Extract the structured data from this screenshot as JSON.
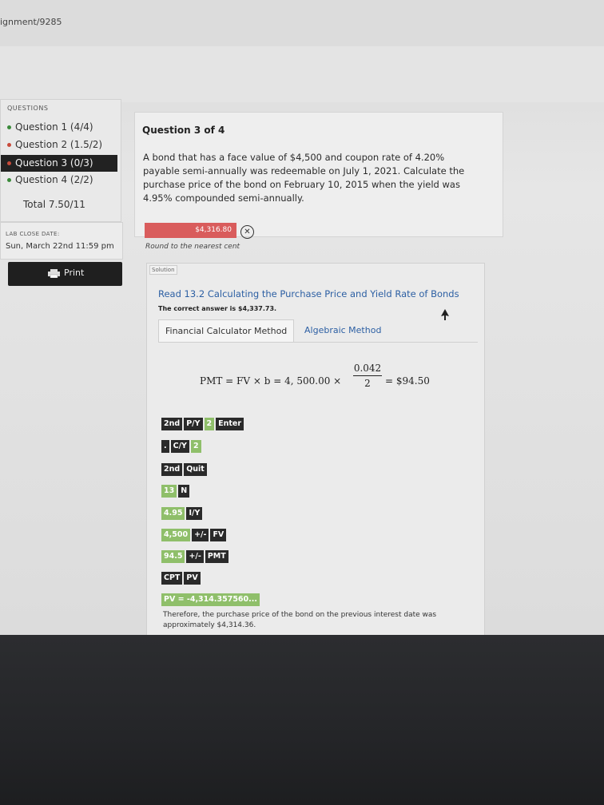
{
  "browser": {
    "url_fragment": "ignment/9285"
  },
  "sidebar": {
    "heading": "QUESTIONS",
    "items": [
      {
        "label": "Question 1 (4/4)",
        "dot_color": "#3a8a3a"
      },
      {
        "label": "Question 2 (1.5/2)",
        "dot_color": "#c84a3a"
      },
      {
        "label": "Question 3 (0/3)",
        "dot_color": "#c84a3a"
      },
      {
        "label": "Question 4 (2/2)",
        "dot_color": "#3a8a3a"
      }
    ],
    "total": "Total 7.50/11",
    "close_date_label": "LAB CLOSE DATE:",
    "close_date_value": "Sun, March 22nd 11:59 pm",
    "print_label": "Print"
  },
  "question": {
    "title": "Question 3 of 4",
    "text": "A bond that has a face value of $4,500 and coupon rate of 4.20% payable semi-annually was redeemable on July 1, 2021. Calculate the purchase price of the bond on February 10, 2015 when the yield was 4.95% compounded semi-annually.",
    "answer": "$4,316.80",
    "hint": "Round to the nearest cent"
  },
  "solution": {
    "label": "Solution",
    "read_link": "Read 13.2 Calculating the Purchase Price and Yield Rate of Bonds",
    "correct_prefix": "The correct answer is ",
    "correct_value": "$4,337.73.",
    "tabs": [
      "Financial Calculator Method",
      "Algebraic Method"
    ],
    "formula_lhs": "PMT = FV × b = 4, 500.00 ×",
    "formula_num": "0.042",
    "formula_den": "2",
    "formula_rhs": "= $94.50",
    "keys": {
      "r1": [
        "2nd",
        "P/Y",
        "2",
        "Enter"
      ],
      "r2": [
        ".",
        "C/Y",
        "2"
      ],
      "r3": [
        "2nd",
        "Quit"
      ],
      "r4": [
        "13",
        "N"
      ],
      "r5": [
        "4.95",
        "I/Y"
      ],
      "r6": [
        "4,500",
        "+/-",
        "FV"
      ],
      "r7": [
        "94.5",
        "+/-",
        "PMT"
      ],
      "r8": [
        "CPT",
        "PV"
      ],
      "r9": "PV = -4,314.357560..."
    },
    "conclusion": "Therefore, the purchase price of the bond on the previous interest date was approximately $4,314.36."
  },
  "colors": {
    "answer_bg": "#d95c5c",
    "key_dark": "#2a2a2a",
    "key_green": "#8fbf6a",
    "link": "#2c5fa3"
  }
}
